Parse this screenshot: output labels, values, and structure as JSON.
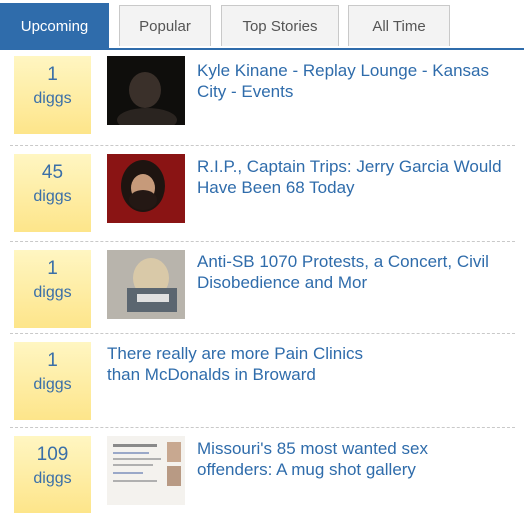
{
  "tabs": [
    {
      "label": "Upcoming",
      "active": true
    },
    {
      "label": "Popular",
      "active": false
    },
    {
      "label": "Top Stories",
      "active": false
    },
    {
      "label": "All Time",
      "active": false
    }
  ],
  "stories": [
    {
      "diggs": "1",
      "unit": "diggs",
      "title": "Kyle Kinane - Replay Lounge - Kansas City - Events"
    },
    {
      "diggs": "45",
      "unit": "diggs",
      "title": "R.I.P., Captain Trips: Jerry Garcia Would Have Been 68 Today"
    },
    {
      "diggs": "1",
      "unit": "diggs",
      "title": "Anti-SB 1070 Protests, a Concert, Civil Disobedience and Mor"
    },
    {
      "diggs": "1",
      "unit": "diggs",
      "title": "There really are more Pain Clinics than McDonalds in Broward"
    },
    {
      "diggs": "109",
      "unit": "diggs",
      "title": "Missouri's 85 most wanted sex offenders: A mug shot gallery"
    }
  ],
  "colors": {
    "accent": "#2f6cab",
    "digg_box": "#fde58a"
  }
}
